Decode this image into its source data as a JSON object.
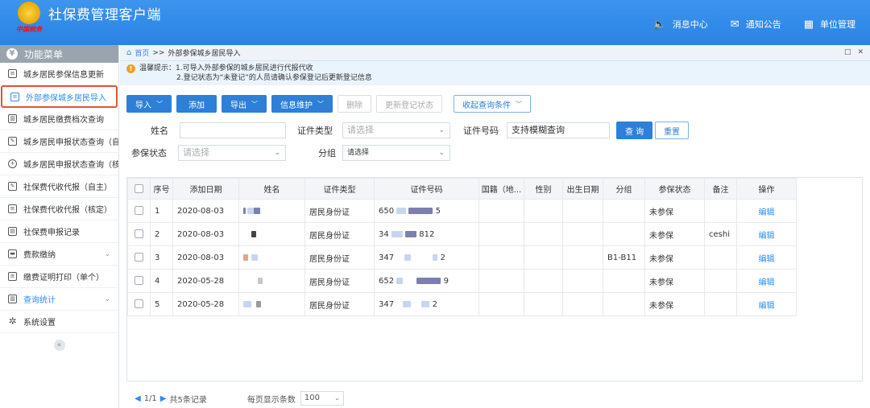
{
  "header": {
    "title": "社保费管理客户端",
    "emblem_text": "中国税务",
    "nav": [
      {
        "icon": "speaker-icon",
        "label": "消息中心"
      },
      {
        "icon": "mail-icon",
        "label": "通知公告"
      },
      {
        "icon": "building-icon",
        "label": "单位管理"
      }
    ]
  },
  "sidebar": {
    "heading": "功能菜单",
    "items": [
      {
        "label": "城乡居民参保信息更新"
      },
      {
        "label": "外部参保城乡居民导入"
      },
      {
        "label": "城乡居民缴费档次查询"
      },
      {
        "label": "城乡居民申报状态查询（自主"
      },
      {
        "label": "城乡居民申报状态查询（核定"
      },
      {
        "label": "社保费代收代报（自主）"
      },
      {
        "label": "社保费代收代报（核定）"
      },
      {
        "label": "社保费申报记录"
      },
      {
        "label": "费款缴纳"
      },
      {
        "label": "缴费证明打印（单个）"
      },
      {
        "label": "查询统计"
      },
      {
        "label": "系统设置"
      }
    ],
    "collapse_glyph": "«"
  },
  "breadcrumb": {
    "home": "首页",
    "sep": ">>",
    "current": "外部参保城乡居民导入",
    "ctrl_restore": "□",
    "ctrl_close": "✕"
  },
  "tips": {
    "label": "温馨提示：",
    "line1": "1.可导入外部参保的城乡居民进行代报代收",
    "line2": "2.登记状态为“未登记”的人员请确认参保登记后更新登记信息"
  },
  "toolbar": {
    "import": "导入",
    "add": "添加",
    "export": "导出",
    "info_maintain": "信息维护",
    "delete": "删除",
    "update_reg": "更新登记状态",
    "collapse_query": "收起查询条件"
  },
  "filters": {
    "name_label": "姓名",
    "name_value": "",
    "idtype_label": "证件类型",
    "idtype_placeholder": "请选择",
    "idno_label": "证件号码",
    "idno_value": "支持模糊查询",
    "search": "查 询",
    "reset": "重置",
    "status_label": "参保状态",
    "status_placeholder": "请选择",
    "group_label": "分组",
    "group_placeholder": "请选择"
  },
  "table": {
    "columns": [
      "",
      "序号",
      "添加日期",
      "姓名",
      "证件类型",
      "证件号码",
      "国籍（地...",
      "性别",
      "出生日期",
      "分组",
      "参保状态",
      "备注",
      "操作"
    ],
    "rows": [
      {
        "no": "1",
        "date": "2020-08-03",
        "idtype": "居民身份证",
        "idno_pre": "650",
        "idno_suf": "5",
        "group": "",
        "status": "未参保",
        "remark": "",
        "op": "编辑"
      },
      {
        "no": "2",
        "date": "2020-08-03",
        "idtype": "居民身份证",
        "idno_pre": "34",
        "idno_suf": "812",
        "group": "",
        "status": "未参保",
        "remark": "ceshi",
        "op": "编辑"
      },
      {
        "no": "3",
        "date": "2020-08-03",
        "idtype": "居民身份证",
        "idno_pre": "347",
        "idno_suf": "2",
        "group": "B1-B11",
        "status": "未参保",
        "remark": "",
        "op": "编辑"
      },
      {
        "no": "4",
        "date": "2020-05-28",
        "idtype": "居民身份证",
        "idno_pre": "652",
        "idno_suf": "9",
        "group": "",
        "status": "未参保",
        "remark": "",
        "op": "编辑"
      },
      {
        "no": "5",
        "date": "2020-05-28",
        "idtype": "居民身份证",
        "idno_pre": "347",
        "idno_suf": "2",
        "group": "",
        "status": "未参保",
        "remark": "",
        "op": "编辑"
      }
    ]
  },
  "pager": {
    "info": "1/1",
    "total_text": "共5条记录",
    "page_size_label": "每页显示条数",
    "page_size": "100"
  }
}
